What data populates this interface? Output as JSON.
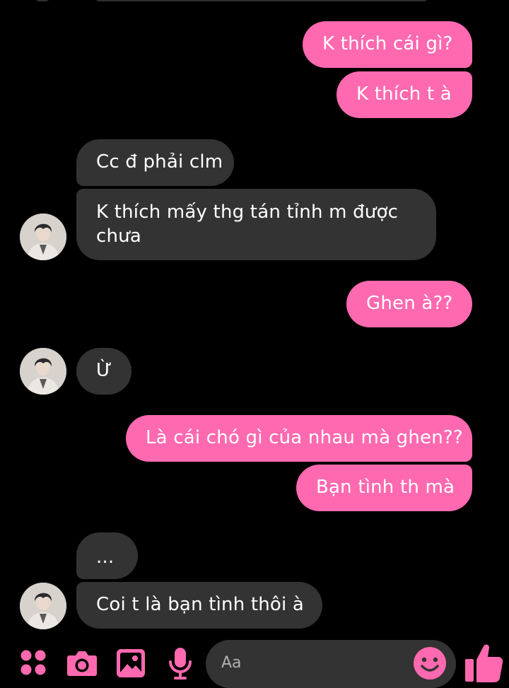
{
  "conversation": {
    "messages": [
      {
        "from": "me",
        "text": "K thích cái gì?"
      },
      {
        "from": "me",
        "text": "K thích t à"
      },
      {
        "from": "them",
        "text": "Cc đ phải clm"
      },
      {
        "from": "them",
        "text": "K thích mấy thg tán tỉnh m được chưa"
      },
      {
        "from": "me",
        "text": "Ghen à??"
      },
      {
        "from": "them",
        "text": "Ừ"
      },
      {
        "from": "me",
        "text": "Là cái chó gì của nhau mà ghen??"
      },
      {
        "from": "me",
        "text": "Bạn tình th mà"
      },
      {
        "from": "them",
        "text": "..."
      },
      {
        "from": "them",
        "text": "Coi t là bạn tình thôi à"
      }
    ]
  },
  "composer": {
    "placeholder": "Aa",
    "icons": [
      "apps-icon",
      "camera-icon",
      "gallery-icon",
      "microphone-icon",
      "emoji-icon",
      "like-icon"
    ]
  },
  "colors": {
    "background": "#000000",
    "outgoing_bubble": "#ff69b0",
    "incoming_bubble": "#333333",
    "accent": "#ff69b0"
  }
}
